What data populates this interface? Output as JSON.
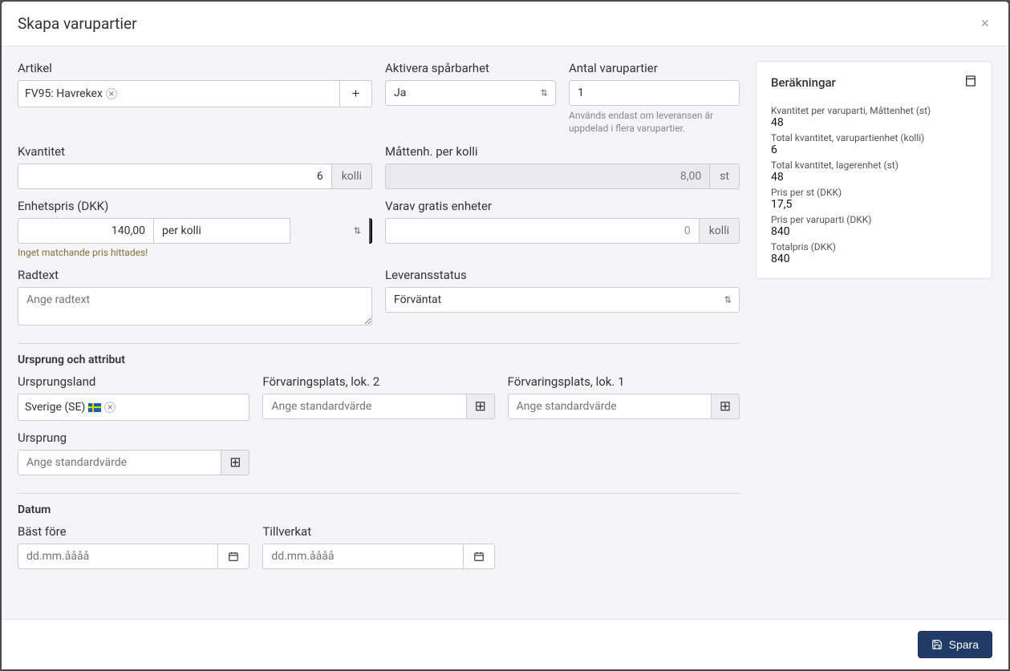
{
  "header": {
    "title": "Skapa varupartier"
  },
  "fields": {
    "article": {
      "label": "Artikel",
      "tag": "FV95: Havrekex"
    },
    "traceability": {
      "label": "Aktivera spårbarhet",
      "value": "Ja"
    },
    "batchCount": {
      "label": "Antal varupartier",
      "value": "1",
      "help": "Används endast om leveransen är uppdelad i flera varupartier."
    },
    "quantity": {
      "label": "Kvantitet",
      "value": "6",
      "unit": "kolli"
    },
    "unitsPerKolli": {
      "label": "Måttenh. per kolli",
      "value": "8,00",
      "unit": "st"
    },
    "unitPrice": {
      "label": "Enhetspris (DKK)",
      "value": "140,00",
      "per": "per kolli",
      "warn": "Inget matchande pris hittades!"
    },
    "freeUnits": {
      "label": "Varav gratis enheter",
      "value": "0",
      "unit": "kolli"
    },
    "rowText": {
      "label": "Radtext",
      "placeholder": "Ange radtext"
    },
    "deliveryStatus": {
      "label": "Leveransstatus",
      "value": "Förväntat"
    }
  },
  "section1": {
    "title": "Ursprung och attribut",
    "originCountry": {
      "label": "Ursprungsland",
      "tag": "Sverige (SE)"
    },
    "storage2": {
      "label": "Förvaringsplats, lok. 2",
      "placeholder": "Ange standardvärde"
    },
    "storage1": {
      "label": "Förvaringsplats, lok. 1",
      "placeholder": "Ange standardvärde"
    },
    "origin": {
      "label": "Ursprung",
      "placeholder": "Ange standardvärde"
    }
  },
  "section2": {
    "title": "Datum",
    "bestBefore": {
      "label": "Bäst före",
      "placeholder": "dd.mm.åååå"
    },
    "manufactured": {
      "label": "Tillverkat",
      "placeholder": "dd.mm.åååå"
    }
  },
  "calc": {
    "title": "Beräkningar",
    "rows": [
      {
        "label": "Kvantitet per varuparti, Måttenhet (st)",
        "value": "48"
      },
      {
        "label": "Total kvantitet, varupartienhet (kolli)",
        "value": "6"
      },
      {
        "label": "Total kvantitet, lagerenhet (st)",
        "value": "48"
      },
      {
        "label": "Pris per st (DKK)",
        "value": "17,5"
      },
      {
        "label": "Pris per varuparti (DKK)",
        "value": "840"
      },
      {
        "label": "Totalpris (DKK)",
        "value": "840"
      }
    ]
  },
  "footer": {
    "save": "Spara"
  }
}
